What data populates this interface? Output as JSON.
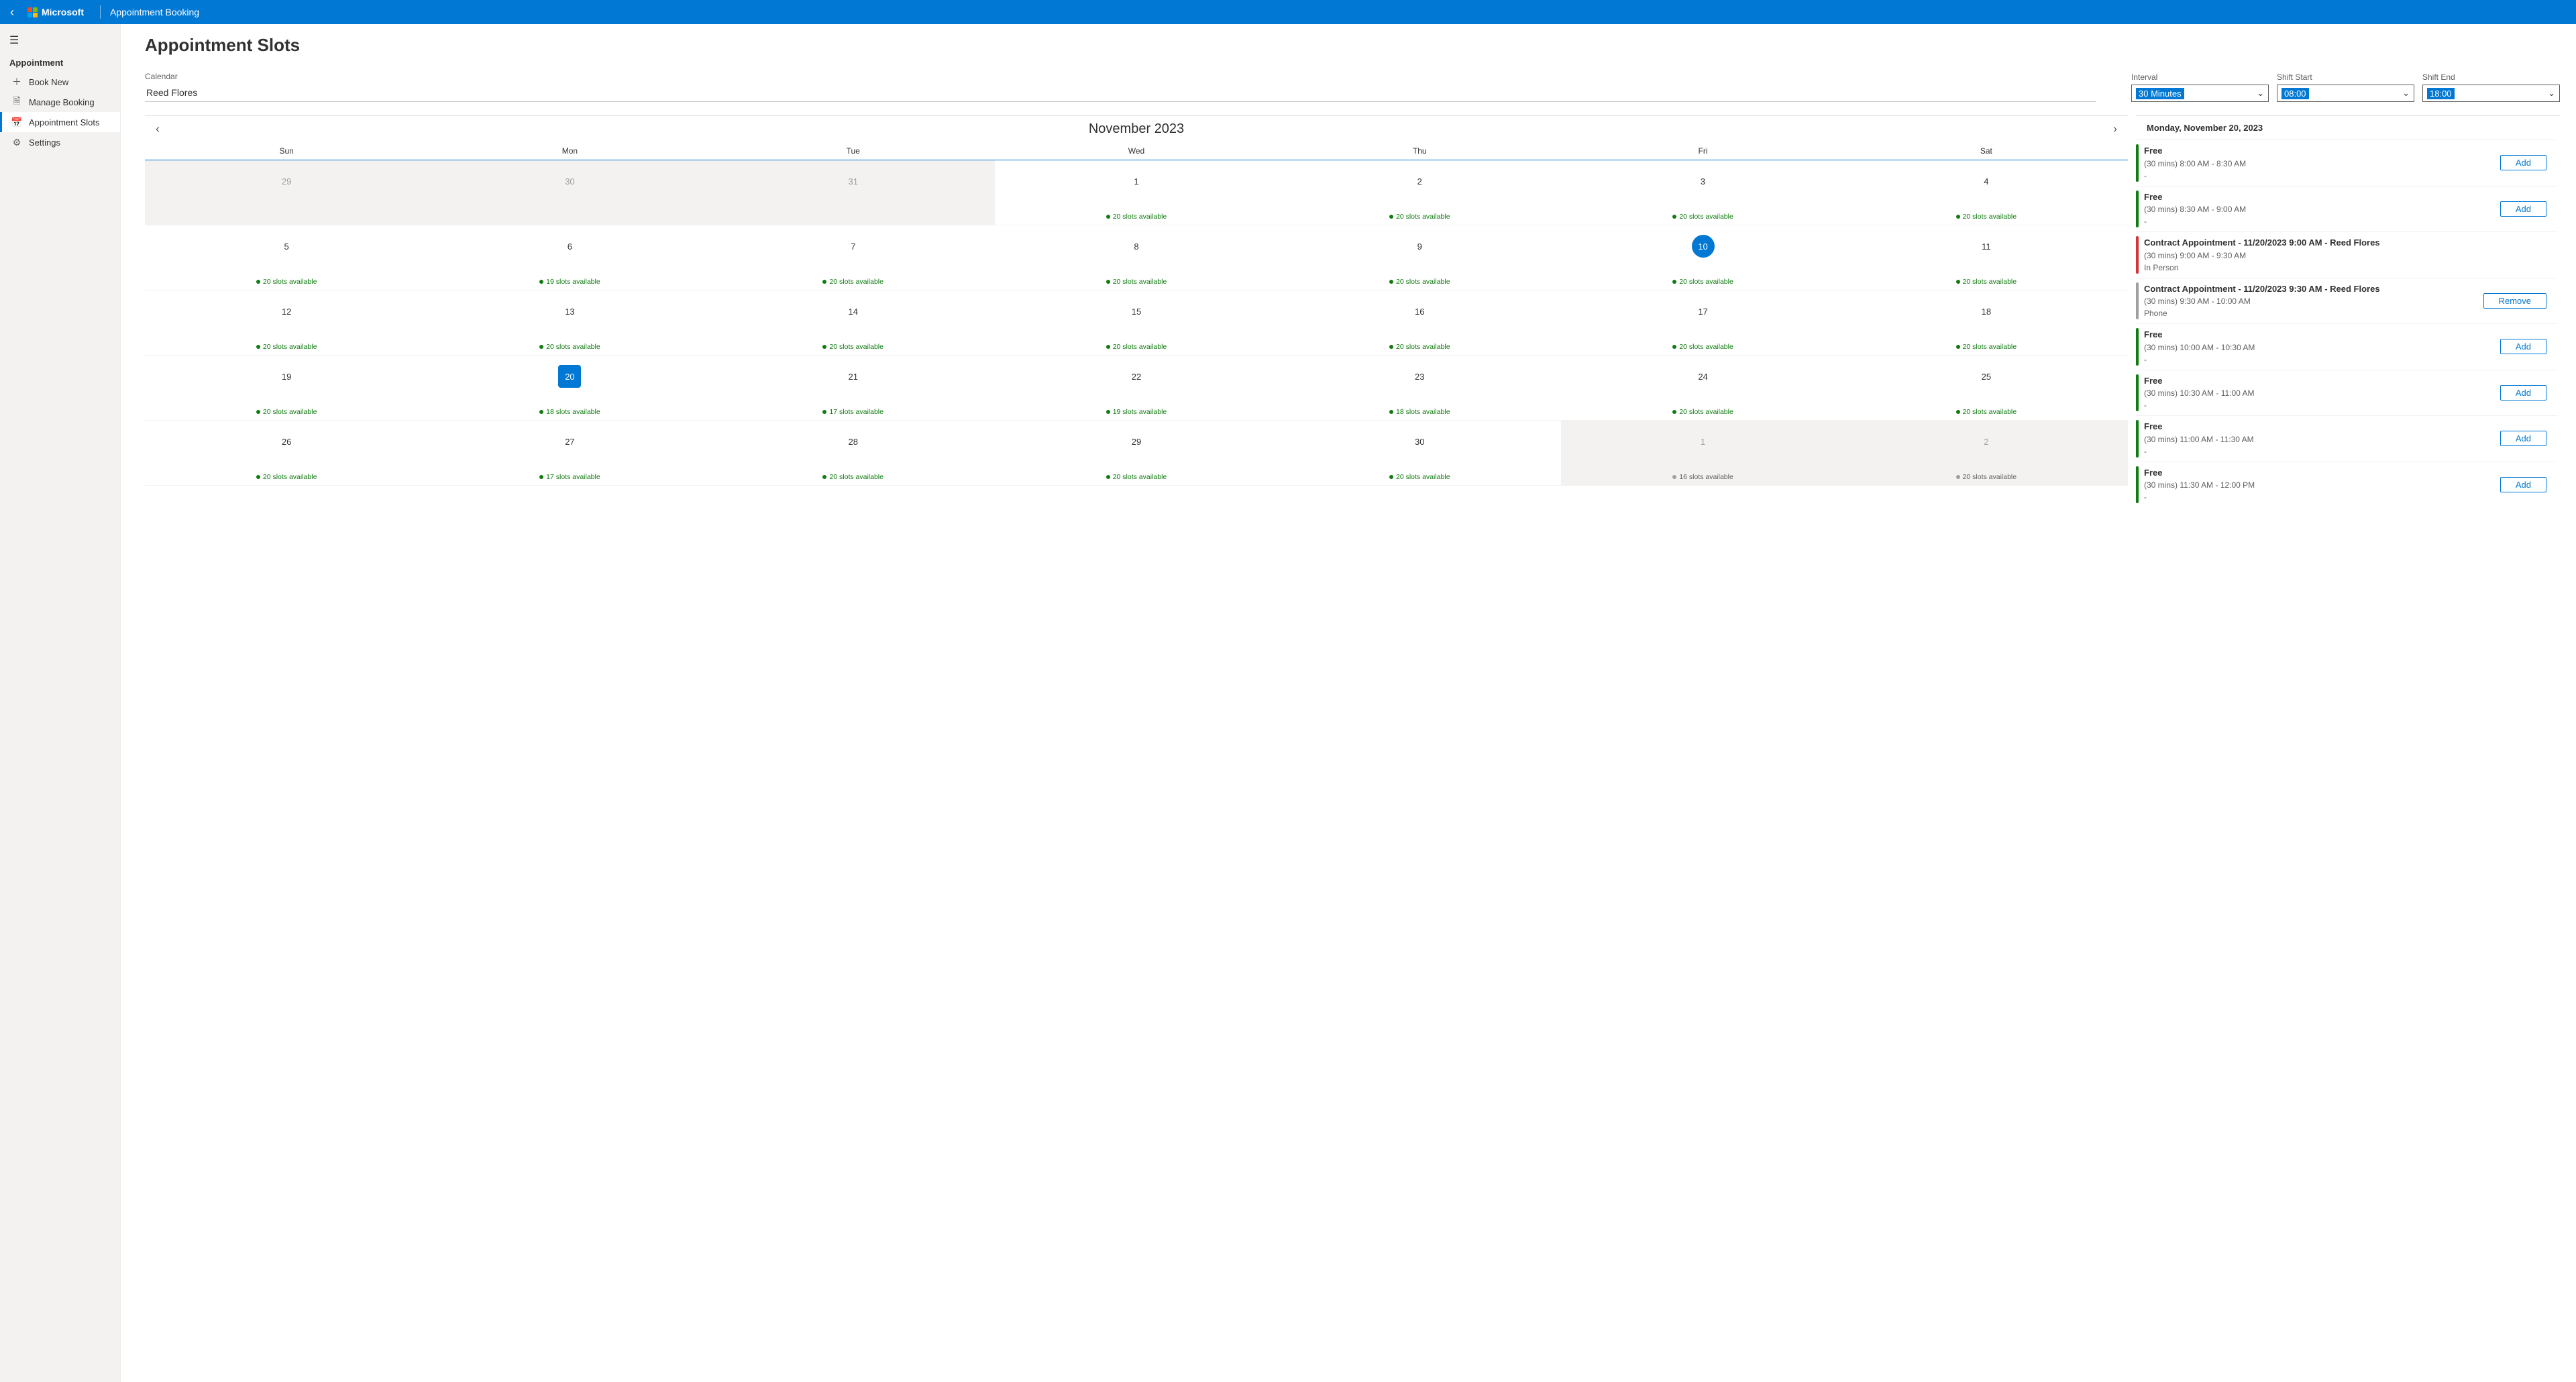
{
  "header": {
    "brand": "Microsoft",
    "app": "Appointment Booking"
  },
  "sidebar": {
    "section": "Appointment",
    "items": [
      {
        "label": "Book New",
        "icon": "plus"
      },
      {
        "label": "Manage Booking",
        "icon": "doc"
      },
      {
        "label": "Appointment Slots",
        "icon": "calendar",
        "active": true
      },
      {
        "label": "Settings",
        "icon": "gear"
      }
    ]
  },
  "page_title": "Appointment Slots",
  "controls": {
    "calendar_label": "Calendar",
    "calendar_value": "Reed Flores",
    "interval_label": "Interval",
    "interval_value": "30 Minutes",
    "shift_start_label": "Shift Start",
    "shift_start_value": "08:00",
    "shift_end_label": "Shift End",
    "shift_end_value": "18:00"
  },
  "calendar": {
    "month_label": "November 2023",
    "dow": [
      "Sun",
      "Mon",
      "Tue",
      "Wed",
      "Thu",
      "Fri",
      "Sat"
    ],
    "weeks": [
      [
        {
          "n": "29",
          "muted": true
        },
        {
          "n": "30",
          "muted": true
        },
        {
          "n": "31",
          "muted": true
        },
        {
          "n": "1",
          "slots": "20 slots available"
        },
        {
          "n": "2",
          "slots": "20 slots available"
        },
        {
          "n": "3",
          "slots": "20 slots available"
        },
        {
          "n": "4",
          "slots": "20 slots available"
        }
      ],
      [
        {
          "n": "5",
          "slots": "20 slots available"
        },
        {
          "n": "6",
          "slots": "19 slots available"
        },
        {
          "n": "7",
          "slots": "20 slots available"
        },
        {
          "n": "8",
          "slots": "20 slots available"
        },
        {
          "n": "9",
          "slots": "20 slots available"
        },
        {
          "n": "10",
          "slots": "20 slots available",
          "today": true
        },
        {
          "n": "11",
          "slots": "20 slots available"
        }
      ],
      [
        {
          "n": "12",
          "slots": "20 slots available"
        },
        {
          "n": "13",
          "slots": "20 slots available"
        },
        {
          "n": "14",
          "slots": "20 slots available"
        },
        {
          "n": "15",
          "slots": "20 slots available"
        },
        {
          "n": "16",
          "slots": "20 slots available"
        },
        {
          "n": "17",
          "slots": "20 slots available"
        },
        {
          "n": "18",
          "slots": "20 slots available"
        }
      ],
      [
        {
          "n": "19",
          "slots": "20 slots available"
        },
        {
          "n": "20",
          "slots": "18 slots available",
          "selected": true
        },
        {
          "n": "21",
          "slots": "17 slots available"
        },
        {
          "n": "22",
          "slots": "19 slots available"
        },
        {
          "n": "23",
          "slots": "18 slots available"
        },
        {
          "n": "24",
          "slots": "20 slots available"
        },
        {
          "n": "25",
          "slots": "20 slots available"
        }
      ],
      [
        {
          "n": "26",
          "slots": "20 slots available"
        },
        {
          "n": "27",
          "slots": "17 slots available"
        },
        {
          "n": "28",
          "slots": "20 slots available"
        },
        {
          "n": "29",
          "slots": "20 slots available"
        },
        {
          "n": "30",
          "slots": "20 slots available"
        },
        {
          "n": "1",
          "muted": true,
          "slots": "16 slots available",
          "gray": true
        },
        {
          "n": "2",
          "muted": true,
          "slots": "20 slots available",
          "gray": true
        }
      ]
    ]
  },
  "panel": {
    "date_label": "Monday, November 20, 2023",
    "slots": [
      {
        "bar": "green",
        "title": "Free",
        "sub": "(30 mins) 8:00 AM - 8:30 AM",
        "meta": "-",
        "btn": "Add"
      },
      {
        "bar": "green",
        "title": "Free",
        "sub": "(30 mins) 8:30 AM - 9:00 AM",
        "meta": "-",
        "btn": "Add"
      },
      {
        "bar": "red",
        "title": "Contract Appointment - 11/20/2023 9:00 AM  - Reed Flores",
        "sub": "(30 mins) 9:00 AM - 9:30 AM",
        "meta": "In Person",
        "btn": ""
      },
      {
        "bar": "gray",
        "title": "Contract Appointment - 11/20/2023 9:30 AM  - Reed Flores",
        "sub": "(30 mins) 9:30 AM - 10:00 AM",
        "meta": "Phone",
        "btn": "Remove"
      },
      {
        "bar": "green",
        "title": "Free",
        "sub": "(30 mins) 10:00 AM - 10:30 AM",
        "meta": "-",
        "btn": "Add"
      },
      {
        "bar": "green",
        "title": "Free",
        "sub": "(30 mins) 10:30 AM - 11:00 AM",
        "meta": "-",
        "btn": "Add"
      },
      {
        "bar": "green",
        "title": "Free",
        "sub": "(30 mins) 11:00 AM - 11:30 AM",
        "meta": "-",
        "btn": "Add"
      },
      {
        "bar": "green",
        "title": "Free",
        "sub": "(30 mins) 11:30 AM - 12:00 PM",
        "meta": "-",
        "btn": "Add"
      }
    ]
  }
}
